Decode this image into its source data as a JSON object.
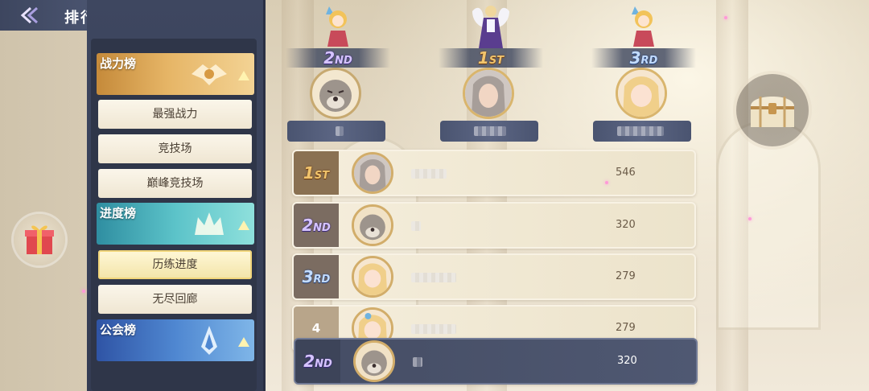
{
  "header": {
    "title": "排行榜"
  },
  "categories": [
    {
      "label": "战力榜",
      "items": [
        "最强战力",
        "竞技场",
        "巅峰竞技场"
      ]
    },
    {
      "label": "进度榜",
      "items": [
        "历练进度",
        "无尽回廊"
      ]
    },
    {
      "label": "公会榜",
      "items": []
    }
  ],
  "active_item": "历练进度",
  "podium": [
    {
      "rank": "2",
      "suffix": "ND"
    },
    {
      "rank": "1",
      "suffix": "ST"
    },
    {
      "rank": "3",
      "suffix": "RD"
    }
  ],
  "rows": [
    {
      "rank": "1",
      "suffix": "ST",
      "score": "546"
    },
    {
      "rank": "2",
      "suffix": "ND",
      "score": "320"
    },
    {
      "rank": "3",
      "suffix": "RD",
      "score": "279"
    },
    {
      "rank": "4",
      "suffix": "",
      "score": "279"
    }
  ],
  "self_row": {
    "rank": "2",
    "suffix": "ND",
    "score": "320"
  },
  "colors": {
    "gold": "#f1c46c",
    "purple": "#d6c4ff",
    "blue": "#c3dcff",
    "panel": "#3e4760"
  }
}
